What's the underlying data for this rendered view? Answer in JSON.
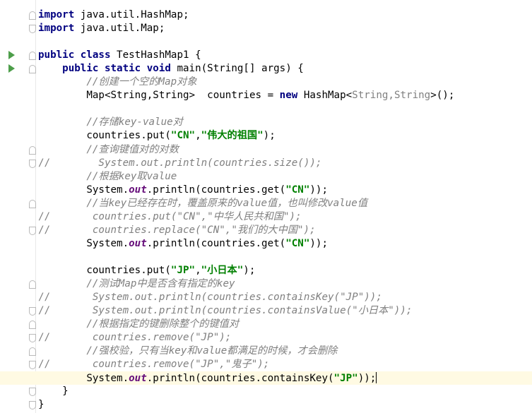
{
  "editor": {
    "lines": [
      {
        "row": 0,
        "fold": "start",
        "run": false,
        "gut": "",
        "parts": [
          [
            "kw",
            "import"
          ],
          [
            "",
            " java.util.HashMap;"
          ]
        ]
      },
      {
        "row": 1,
        "fold": "end",
        "run": false,
        "gut": "",
        "parts": [
          [
            "kw",
            "import"
          ],
          [
            "",
            " java.util.Map;"
          ]
        ]
      },
      {
        "row": 2,
        "fold": "",
        "run": false,
        "gut": "",
        "parts": []
      },
      {
        "row": 3,
        "fold": "start",
        "run": true,
        "gut": "",
        "parts": [
          [
            "kw",
            "public class"
          ],
          [
            "",
            " TestHashMap1 {"
          ]
        ]
      },
      {
        "row": 4,
        "fold": "start",
        "run": true,
        "gut": "",
        "parts": [
          [
            "",
            "    "
          ],
          [
            "kw",
            "public static void"
          ],
          [
            "",
            " main(String[] args) {"
          ]
        ]
      },
      {
        "row": 5,
        "fold": "",
        "run": false,
        "gut": "",
        "parts": [
          [
            "",
            "        "
          ],
          [
            "cmt",
            "//创建一个空的Map对象"
          ]
        ]
      },
      {
        "row": 6,
        "fold": "",
        "run": false,
        "gut": "",
        "parts": [
          [
            "",
            "        Map<String,String>  countries = "
          ],
          [
            "kw",
            "new"
          ],
          [
            "",
            " HashMap<"
          ],
          [
            "gen",
            "String,String"
          ],
          [
            "",
            ">();"
          ]
        ]
      },
      {
        "row": 7,
        "fold": "",
        "run": false,
        "gut": "",
        "parts": []
      },
      {
        "row": 8,
        "fold": "",
        "run": false,
        "gut": "",
        "parts": [
          [
            "",
            "        "
          ],
          [
            "cmt",
            "//存储key-value对"
          ]
        ]
      },
      {
        "row": 9,
        "fold": "",
        "run": false,
        "gut": "",
        "parts": [
          [
            "",
            "        countries.put("
          ],
          [
            "str",
            "\"CN\""
          ],
          [
            "",
            ","
          ],
          [
            "str",
            "\"伟大的祖国\""
          ],
          [
            "",
            ");"
          ]
        ]
      },
      {
        "row": 10,
        "fold": "start",
        "run": false,
        "gut": "",
        "parts": [
          [
            "",
            "        "
          ],
          [
            "cmt",
            "//查询键值对的对数"
          ]
        ]
      },
      {
        "row": 11,
        "fold": "end",
        "run": false,
        "gut": "//",
        "parts": [
          [
            "",
            "          "
          ],
          [
            "cmt",
            "System.out.println(countries.size());"
          ]
        ]
      },
      {
        "row": 12,
        "fold": "",
        "run": false,
        "gut": "",
        "parts": [
          [
            "",
            "        "
          ],
          [
            "cmt",
            "//根据key取value"
          ]
        ]
      },
      {
        "row": 13,
        "fold": "",
        "run": false,
        "gut": "",
        "parts": [
          [
            "",
            "        System."
          ],
          [
            "field",
            "out"
          ],
          [
            "",
            ".println(countries.get("
          ],
          [
            "str",
            "\"CN\""
          ],
          [
            "",
            "));"
          ]
        ]
      },
      {
        "row": 14,
        "fold": "start",
        "run": false,
        "gut": "",
        "parts": [
          [
            "",
            "        "
          ],
          [
            "cmt",
            "//当key已经存在时，覆盖原来的value值，也叫修改value值"
          ]
        ]
      },
      {
        "row": 15,
        "fold": "",
        "run": false,
        "gut": "//",
        "parts": [
          [
            "",
            "         "
          ],
          [
            "cmt",
            "countries.put(\"CN\",\"中华人民共和国\");"
          ]
        ]
      },
      {
        "row": 16,
        "fold": "end",
        "run": false,
        "gut": "//",
        "parts": [
          [
            "",
            "         "
          ],
          [
            "cmt",
            "countries.replace(\"CN\",\"我们的大中国\");"
          ]
        ]
      },
      {
        "row": 17,
        "fold": "",
        "run": false,
        "gut": "",
        "parts": [
          [
            "",
            "        System."
          ],
          [
            "field",
            "out"
          ],
          [
            "",
            ".println(countries.get("
          ],
          [
            "str",
            "\"CN\""
          ],
          [
            "",
            "));"
          ]
        ]
      },
      {
        "row": 18,
        "fold": "",
        "run": false,
        "gut": "",
        "parts": []
      },
      {
        "row": 19,
        "fold": "",
        "run": false,
        "gut": "",
        "parts": [
          [
            "",
            "        countries.put("
          ],
          [
            "str",
            "\"JP\""
          ],
          [
            "",
            ","
          ],
          [
            "str",
            "\"小日本\""
          ],
          [
            "",
            ");"
          ]
        ]
      },
      {
        "row": 20,
        "fold": "start",
        "run": false,
        "gut": "",
        "parts": [
          [
            "",
            "        "
          ],
          [
            "cmt",
            "//测试Map中是否含有指定的key"
          ]
        ]
      },
      {
        "row": 21,
        "fold": "",
        "run": false,
        "gut": "//",
        "parts": [
          [
            "",
            "         "
          ],
          [
            "cmt",
            "System.out.println(countries.containsKey(\"JP\"));"
          ]
        ]
      },
      {
        "row": 22,
        "fold": "end",
        "run": false,
        "gut": "//",
        "parts": [
          [
            "",
            "         "
          ],
          [
            "cmt",
            "System.out.println(countries.containsValue(\"小日本\"));"
          ]
        ]
      },
      {
        "row": 23,
        "fold": "start",
        "run": false,
        "gut": "",
        "parts": [
          [
            "",
            "        "
          ],
          [
            "cmt",
            "//根据指定的键删除整个的键值对"
          ]
        ]
      },
      {
        "row": 24,
        "fold": "end",
        "run": false,
        "gut": "//",
        "parts": [
          [
            "",
            "         "
          ],
          [
            "cmt",
            "countries.remove(\"JP\");"
          ]
        ]
      },
      {
        "row": 25,
        "fold": "start",
        "run": false,
        "gut": "",
        "parts": [
          [
            "",
            "        "
          ],
          [
            "cmt",
            "//强校验，只有当key和value都满足的时候，才会删除"
          ]
        ]
      },
      {
        "row": 26,
        "fold": "end",
        "run": false,
        "gut": "//",
        "parts": [
          [
            "",
            "         "
          ],
          [
            "cmt",
            "countries.remove(\"JP\",\"鬼子\");"
          ]
        ]
      },
      {
        "row": 27,
        "fold": "",
        "run": false,
        "gut": "",
        "current": true,
        "parts": [
          [
            "",
            "        System."
          ],
          [
            "field",
            "out"
          ],
          [
            "",
            ".println(countries.containsKey("
          ],
          [
            "str",
            "\"JP\""
          ],
          [
            "",
            "));"
          ]
        ]
      },
      {
        "row": 28,
        "fold": "end",
        "run": false,
        "gut": "",
        "parts": [
          [
            "",
            "    }"
          ]
        ]
      },
      {
        "row": 29,
        "fold": "end",
        "run": false,
        "gut": "",
        "parts": [
          [
            "",
            "}"
          ]
        ]
      }
    ]
  }
}
